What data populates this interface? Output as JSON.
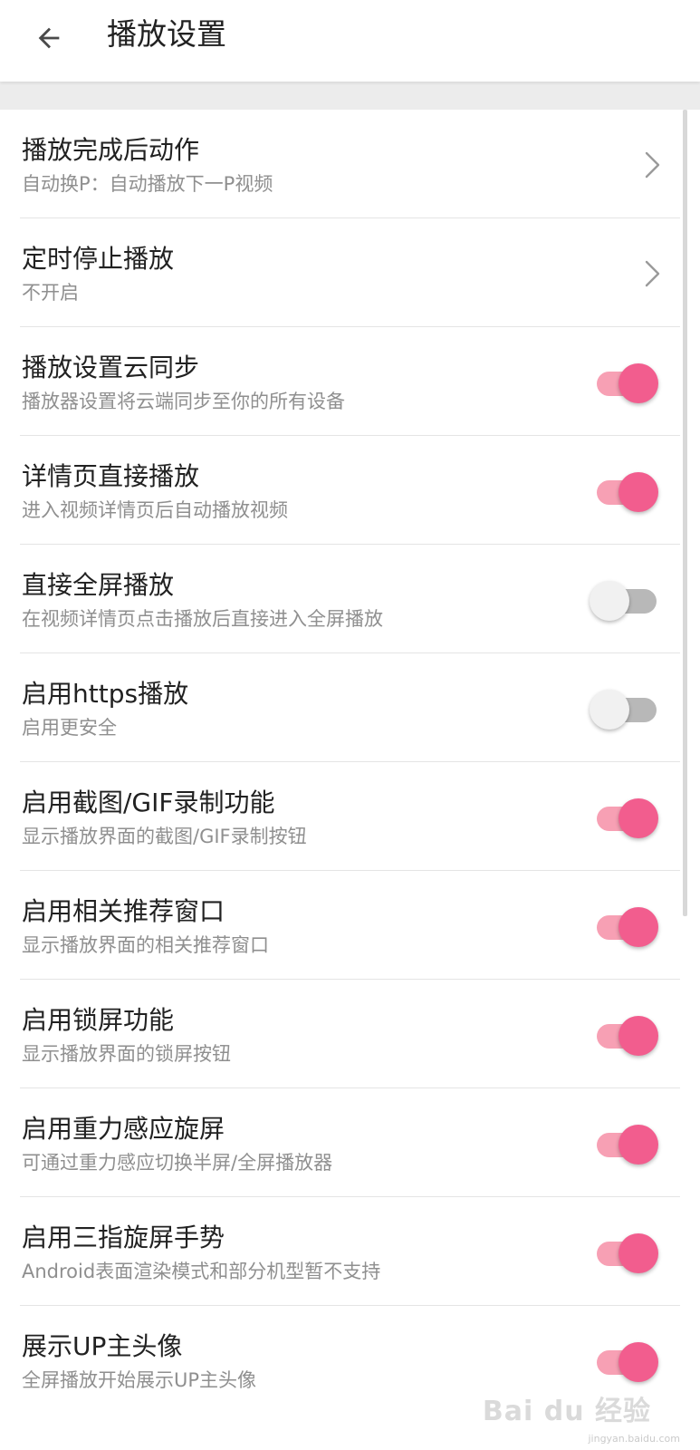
{
  "header": {
    "title": "播放设置",
    "back_icon": "arrow-left-icon"
  },
  "colors": {
    "accent": "#f25d8e",
    "accent_track": "#f7a0b4",
    "off_track": "#b8b8b8",
    "title_text": "#212121",
    "subtitle_text": "#8f8f8f"
  },
  "settings": [
    {
      "title": "播放完成后动作",
      "subtitle": "自动换P：自动播放下一P视频",
      "control": "chevron"
    },
    {
      "title": "定时停止播放",
      "subtitle": "不开启",
      "control": "chevron"
    },
    {
      "title": "播放设置云同步",
      "subtitle": "播放器设置将云端同步至你的所有设备",
      "control": "switch",
      "on": true
    },
    {
      "title": "详情页直接播放",
      "subtitle": "进入视频详情页后自动播放视频",
      "control": "switch",
      "on": true
    },
    {
      "title": "直接全屏播放",
      "subtitle": "在视频详情页点击播放后直接进入全屏播放",
      "control": "switch",
      "on": false
    },
    {
      "title": "启用https播放",
      "subtitle": "启用更安全",
      "control": "switch",
      "on": false
    },
    {
      "title": "启用截图/GIF录制功能",
      "subtitle": "显示播放界面的截图/GIF录制按钮",
      "control": "switch",
      "on": true
    },
    {
      "title": "启用相关推荐窗口",
      "subtitle": "显示播放界面的相关推荐窗口",
      "control": "switch",
      "on": true
    },
    {
      "title": "启用锁屏功能",
      "subtitle": "显示播放界面的锁屏按钮",
      "control": "switch",
      "on": true
    },
    {
      "title": "启用重力感应旋屏",
      "subtitle": "可通过重力感应切换半屏/全屏播放器",
      "control": "switch",
      "on": true
    },
    {
      "title": "启用三指旋屏手势",
      "subtitle": "Android表面渲染模式和部分机型暂不支持",
      "control": "switch",
      "on": true
    },
    {
      "title": "展示UP主头像",
      "subtitle": "全屏播放开始展示UP主头像",
      "control": "switch",
      "on": true
    }
  ],
  "watermark": {
    "text": "Bai du 经验",
    "url": "jingyan.baidu.com"
  }
}
